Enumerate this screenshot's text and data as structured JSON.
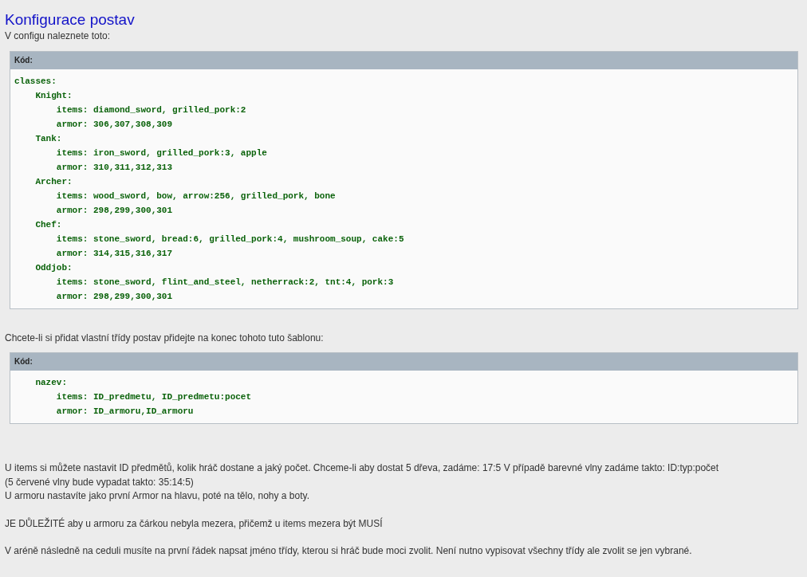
{
  "title": "Konfigurace postav",
  "intro": "V configu naleznete toto:",
  "code_blocks": [
    {
      "header": "Kód:",
      "lines": [
        "classes:",
        "    Knight:",
        "        items: diamond_sword, grilled_pork:2",
        "        armor: 306,307,308,309",
        "    Tank:",
        "        items: iron_sword, grilled_pork:3, apple",
        "        armor: 310,311,312,313",
        "    Archer:",
        "        items: wood_sword, bow, arrow:256, grilled_pork, bone",
        "        armor: 298,299,300,301",
        "    Chef:",
        "        items: stone_sword, bread:6, grilled_pork:4, mushroom_soup, cake:5",
        "        armor: 314,315,316,317",
        "    Oddjob:",
        "        items: stone_sword, flint_and_steel, netherrack:2, tnt:4, pork:3",
        "        armor: 298,299,300,301"
      ]
    },
    {
      "header": "Kód:",
      "lines": [
        "    nazev:",
        "        items: ID_predmetu, ID_predmetu:pocet",
        "        armor: ID_armoru,ID_armoru"
      ]
    }
  ],
  "between": "Chcete-li si přidat vlastní třídy postav přidejte na konec tohoto tuto šablonu:",
  "paragraphs": [
    [
      "U items si můžete nastavit ID předmětů, kolik hráč dostane a jaký počet. Chceme-li aby dostat 5 dřeva, zadáme: 17:5 V případě barevné vlny zadáme takto: ID:typ:počet",
      "(5 červené vlny bude vypadat takto: 35:14:5)",
      "U armoru nastavíte jako první Armor na hlavu, poté na tělo, nohy a boty."
    ],
    [
      "JE DŮLEŽITÉ aby u armoru za čárkou nebyla mezera, přičemž u items mezera být MUSÍ"
    ],
    [
      "V aréně následně na ceduli musíte na první řádek napsat jméno třídy, kterou si hráč bude moci zvolit. Není nutno vypisovat všechny třídy ale zvolit se jen vybrané."
    ]
  ]
}
